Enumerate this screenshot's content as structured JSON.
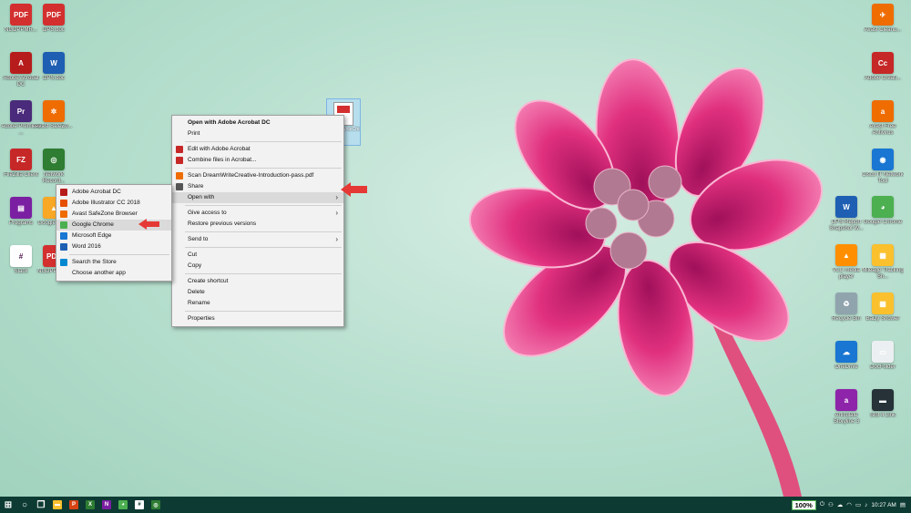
{
  "desktop": {
    "left_icons": [
      {
        "label": "NGDPPMR...",
        "glyph": "PDF",
        "color": "#d32f2f"
      },
      {
        "label": "DPS.doc",
        "glyph": "PDF",
        "color": "#d32f2f"
      },
      {
        "label": "Adobe Acrobat DC",
        "glyph": "A",
        "color": "#b71c1c"
      },
      {
        "label": "DPS.doc",
        "glyph": "W",
        "color": "#1e5fb3"
      },
      {
        "label": "Adobe Premiere ...",
        "glyph": "Pr",
        "color": "#4a2a7a"
      },
      {
        "label": "Avast SafeZo...",
        "glyph": "✲",
        "color": "#ef6c00"
      },
      {
        "label": "FileZilla Client",
        "glyph": "FZ",
        "color": "#c62828"
      },
      {
        "label": "Network Record...",
        "glyph": "◎",
        "color": "#2e7d32"
      },
      {
        "label": "Programs",
        "glyph": "▤",
        "color": "#7b1fa2"
      },
      {
        "label": "Google Drive",
        "glyph": "▲",
        "color": "#f9a825"
      },
      {
        "label": "Slack",
        "glyph": "#",
        "color": "#ffffff"
      },
      {
        "label": "NGDPPMR...",
        "glyph": "PDF",
        "color": "#d32f2f"
      }
    ],
    "right_icons": [
      {
        "label": "Avast Cleanu...",
        "glyph": "✈",
        "color": "#ef6c00"
      },
      {
        "label": "Adobe Creati...",
        "glyph": "Cc",
        "color": "#c62828"
      },
      {
        "label": "Avast Free Antivirus",
        "glyph": "a",
        "color": "#ef6c00"
      },
      {
        "label": "Cisco IT Network Tool",
        "glyph": "◉",
        "color": "#1976d2"
      },
      {
        "label": "DPS-Report Snapshot W...",
        "glyph": "W",
        "color": "#1e5fb3"
      },
      {
        "label": "Google Chrome",
        "glyph": "◕",
        "color": "#4caf50"
      },
      {
        "label": "VLC media player",
        "glyph": "▲",
        "color": "#ff8f00"
      },
      {
        "label": "Mileage Tracking Sh...",
        "glyph": "▦",
        "color": "#fbc02d"
      },
      {
        "label": "Recycle Bin",
        "glyph": "♻",
        "color": "#90a4ae"
      },
      {
        "label": "BaDy Shower",
        "glyph": "▦",
        "color": "#fbc02d"
      },
      {
        "label": "OneDrive",
        "glyph": "☁",
        "color": "#1976d2"
      },
      {
        "label": "DocFolder",
        "glyph": "▭",
        "color": "#eceff1"
      },
      {
        "label": "Articulate Storyline 3",
        "glyph": "a",
        "color": "#8e24aa"
      },
      {
        "label": "Slot 4 Link",
        "glyph": "▬",
        "color": "#263238"
      }
    ],
    "selected_file_label": "DreamWriteCreative..."
  },
  "context_menu": {
    "items": [
      {
        "label": "Open with Adobe Acrobat DC",
        "bold": true
      },
      {
        "label": "Print"
      },
      {
        "sep": true
      },
      {
        "label": "Edit with Adobe Acrobat",
        "icon": "#c62828"
      },
      {
        "label": "Combine files in Acrobat...",
        "icon": "#c62828"
      },
      {
        "sep": true
      },
      {
        "label": "Scan DreamWriteCreative-Introduction-pass.pdf",
        "icon": "#ef6c00"
      },
      {
        "label": "Share",
        "icon": "#555555"
      },
      {
        "label": "Open with",
        "submenu": true,
        "highlight": true
      },
      {
        "sep": true
      },
      {
        "label": "Give access to",
        "submenu": true
      },
      {
        "label": "Restore previous versions"
      },
      {
        "sep": true
      },
      {
        "label": "Send to",
        "submenu": true
      },
      {
        "sep": true
      },
      {
        "label": "Cut"
      },
      {
        "label": "Copy"
      },
      {
        "sep": true
      },
      {
        "label": "Create shortcut"
      },
      {
        "label": "Delete"
      },
      {
        "label": "Rename"
      },
      {
        "sep": true
      },
      {
        "label": "Properties"
      }
    ]
  },
  "open_with_menu": {
    "items": [
      {
        "label": "Adobe Acrobat DC",
        "icon": "#b71c1c"
      },
      {
        "label": "Adobe Illustrator CC 2018",
        "icon": "#e65100"
      },
      {
        "label": "Avast SafeZone Browser",
        "icon": "#ef6c00"
      },
      {
        "label": "Google Chrome",
        "icon": "#4caf50",
        "highlight": true
      },
      {
        "label": "Microsoft Edge",
        "icon": "#1976d2"
      },
      {
        "label": "Word 2016",
        "icon": "#1e5fb3"
      },
      {
        "sep": true
      },
      {
        "label": "Search the Store",
        "icon": "#0288d1"
      },
      {
        "label": "Choose another app"
      }
    ]
  },
  "taskbar": {
    "apps": [
      {
        "name": "start-button",
        "glyph": "⊞",
        "color": "#ffffff"
      },
      {
        "name": "cortana-button",
        "glyph": "○",
        "color": "#ffffff"
      },
      {
        "name": "task-view-button",
        "glyph": "❐",
        "color": "#ffffff"
      },
      {
        "name": "file-explorer",
        "glyph": "▬",
        "color": "#fbc02d"
      },
      {
        "name": "powerpoint",
        "glyph": "P",
        "color": "#d84315"
      },
      {
        "name": "excel",
        "glyph": "X",
        "color": "#2e7d32"
      },
      {
        "name": "onenote",
        "glyph": "N",
        "color": "#7b1fa2"
      },
      {
        "name": "chrome",
        "glyph": "◕",
        "color": "#4caf50"
      },
      {
        "name": "slack",
        "glyph": "#",
        "color": "#ffffff"
      },
      {
        "name": "network-recorder",
        "glyph": "◎",
        "color": "#2e7d32"
      }
    ],
    "battery": "100%",
    "clock": "10:27 AM"
  }
}
